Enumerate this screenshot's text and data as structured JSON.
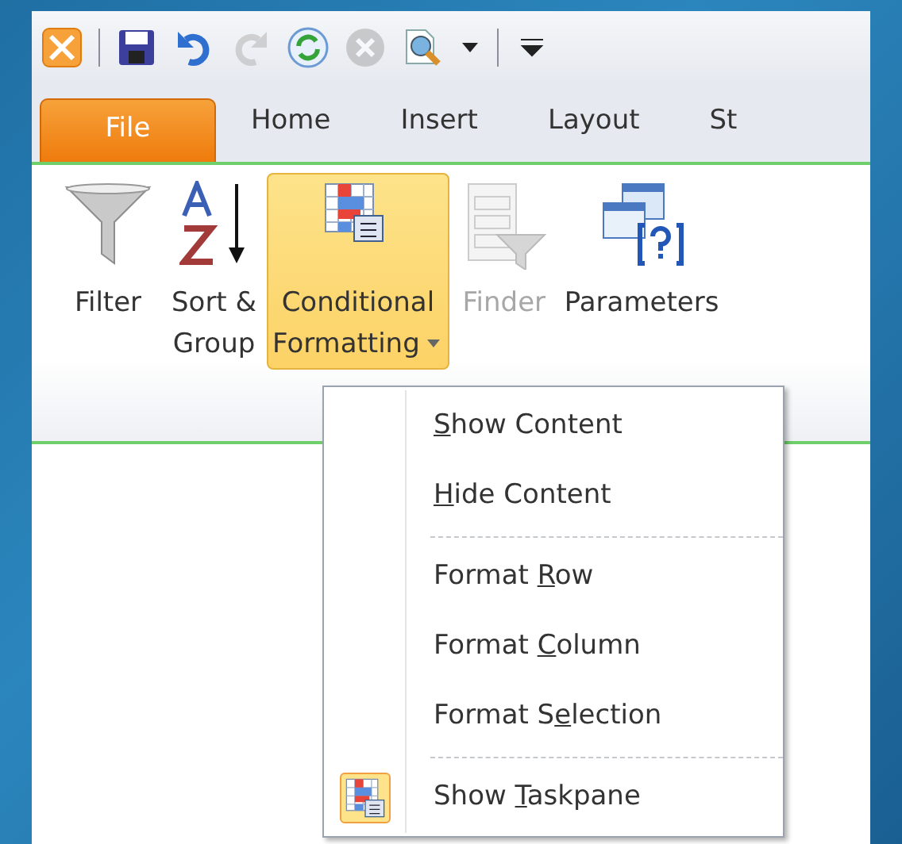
{
  "quick_access": [
    {
      "kind": "app"
    },
    {
      "kind": "sep"
    },
    {
      "kind": "save",
      "disabled": false
    },
    {
      "kind": "undo",
      "disabled": false
    },
    {
      "kind": "redo",
      "disabled": true
    },
    {
      "kind": "refresh",
      "disabled": false
    },
    {
      "kind": "stop",
      "disabled": true
    },
    {
      "kind": "preview",
      "disabled": false
    },
    {
      "kind": "caret"
    },
    {
      "kind": "sep"
    },
    {
      "kind": "customize"
    }
  ],
  "tabs": [
    {
      "label": "File",
      "selected": true
    },
    {
      "label": "Home",
      "selected": false
    },
    {
      "label": "Insert",
      "selected": false
    },
    {
      "label": "Layout",
      "selected": false
    },
    {
      "label": "St",
      "selected": false
    }
  ],
  "ribbon": [
    {
      "kind": "filter",
      "label": [
        "Filter"
      ],
      "disabled": false,
      "open": false
    },
    {
      "kind": "sort",
      "label": [
        "Sort &",
        "Group"
      ],
      "disabled": false,
      "open": false
    },
    {
      "kind": "conditional",
      "label": [
        "Conditional",
        "Formatting"
      ],
      "disabled": false,
      "open": true,
      "dropdown": true
    },
    {
      "kind": "finder",
      "label": [
        "Finder"
      ],
      "disabled": true,
      "open": false
    },
    {
      "kind": "parameters",
      "label": [
        "Parameters"
      ],
      "disabled": false,
      "open": false
    }
  ],
  "menu": [
    {
      "kind": "item",
      "key": "S",
      "after": "how Content",
      "icon": false
    },
    {
      "kind": "item",
      "key": "H",
      "after": "ide Content",
      "icon": false
    },
    {
      "kind": "separator"
    },
    {
      "kind": "item",
      "before": "Format ",
      "key": "R",
      "after": "ow",
      "icon": false
    },
    {
      "kind": "item",
      "before": "Format ",
      "key": "C",
      "after": "olumn",
      "icon": false
    },
    {
      "kind": "item",
      "before": "Format S",
      "key": "e",
      "after": "lection",
      "icon": false
    },
    {
      "kind": "separator"
    },
    {
      "kind": "item",
      "before": "Show ",
      "key": "T",
      "after": "askpane",
      "icon": true
    }
  ]
}
